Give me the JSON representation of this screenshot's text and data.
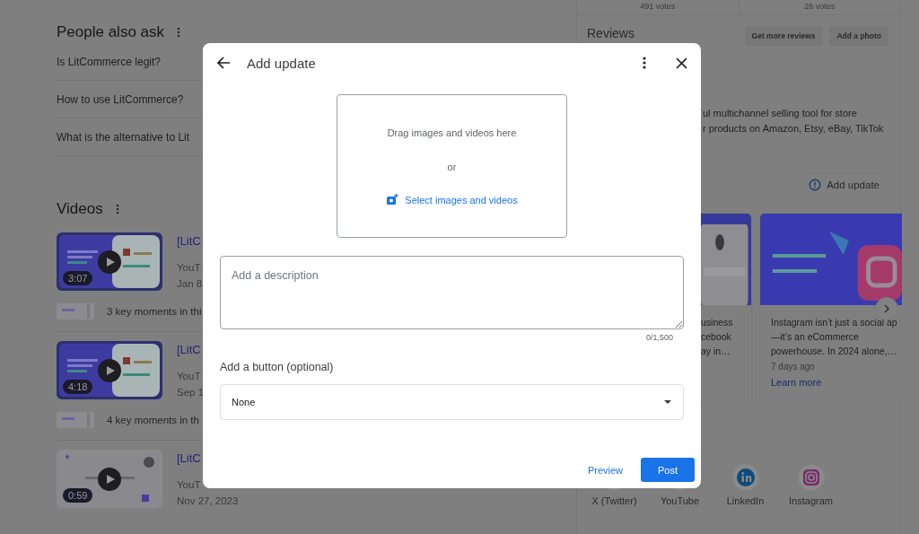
{
  "people_also_ask": {
    "title": "People also ask",
    "questions": [
      "Is LitCommerce legit?",
      "How to use LitCommerce?",
      "What is the alternative to Lit"
    ]
  },
  "videos": {
    "title": "Videos",
    "items": [
      {
        "duration": "3:07",
        "title": "[LitC",
        "source": "YouT",
        "date": "Jan 8",
        "key_moments": "3 key moments in thi"
      },
      {
        "duration": "4:18",
        "title": "[LitC",
        "source": "YouT",
        "date": "Sep 1",
        "key_moments": "4 key moments in th"
      },
      {
        "duration": "0:59",
        "title": "[LitC",
        "source": "YouT",
        "date": "Nov 27, 2023"
      }
    ]
  },
  "side_panel": {
    "votes": [
      "491 votes",
      "26 votes"
    ],
    "reviews_title": "Reviews",
    "review_buttons": [
      "Get more reviews",
      "Add a photo"
    ],
    "description_lines": [
      "ul multichannel selling tool for store",
      "r products on Amazon, Etsy, eBay, TikTok"
    ],
    "add_update": "Add update",
    "posts": [
      {
        "lines": [
          "usiness",
          "cebook",
          "ay in…"
        ]
      },
      {
        "lines": [
          "Instagram isn’t just a social ap",
          "—it’s an eCommerce",
          "powerhouse. In 2024 alone,…"
        ],
        "age": "7 days ago",
        "link": "Learn more"
      }
    ],
    "social": [
      {
        "kind": "x",
        "name": "X (Twitter)"
      },
      {
        "kind": "youtube",
        "name": "YouTube"
      },
      {
        "kind": "linkedin",
        "name": "LinkedIn"
      },
      {
        "kind": "instagram",
        "name": "Instagram"
      }
    ]
  },
  "dialog": {
    "title": "Add update",
    "drop_text": "Drag images and videos here",
    "or": "or",
    "select_link": "Select images and videos",
    "description": {
      "placeholder": "Add a description"
    },
    "counter": "0/1,500",
    "button_label": "Add a button (optional)",
    "button_select": "None",
    "actions": {
      "secondary": "Preview",
      "primary": "Post"
    }
  }
}
